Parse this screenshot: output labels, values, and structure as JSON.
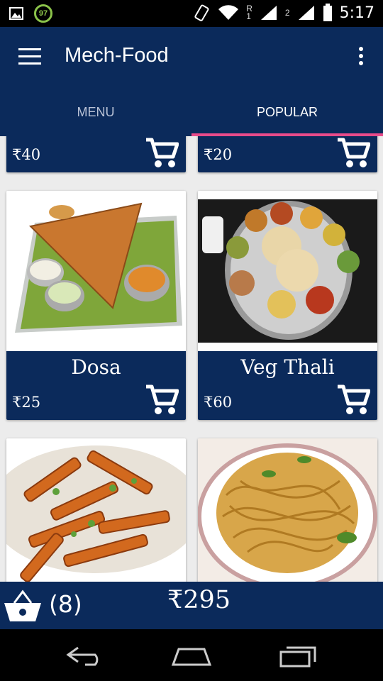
{
  "status_bar": {
    "time": "5:17",
    "notification_badge": "97",
    "sim1_label": "1",
    "sim1_roaming": "R",
    "sim2_label": "2",
    "icons": [
      "image-icon",
      "vibrate-icon",
      "wifi-icon",
      "signal-icon",
      "battery-icon"
    ]
  },
  "app_bar": {
    "title": "Mech-Food",
    "tabs": [
      {
        "label": "MENU",
        "active": false
      },
      {
        "label": "POPULAR",
        "active": true
      }
    ]
  },
  "products": [
    {
      "name": "",
      "price": "₹40"
    },
    {
      "name": "",
      "price": "₹20"
    },
    {
      "name": "Dosa",
      "price": "₹25"
    },
    {
      "name": "Veg Thali",
      "price": "₹60"
    },
    {
      "name": "",
      "price": ""
    },
    {
      "name": "",
      "price": ""
    }
  ],
  "cart": {
    "count": "(8)",
    "total": "₹295"
  },
  "colors": {
    "primary": "#0b2a5b",
    "tab_indicator": "#e94b8a",
    "background": "#ececec"
  }
}
